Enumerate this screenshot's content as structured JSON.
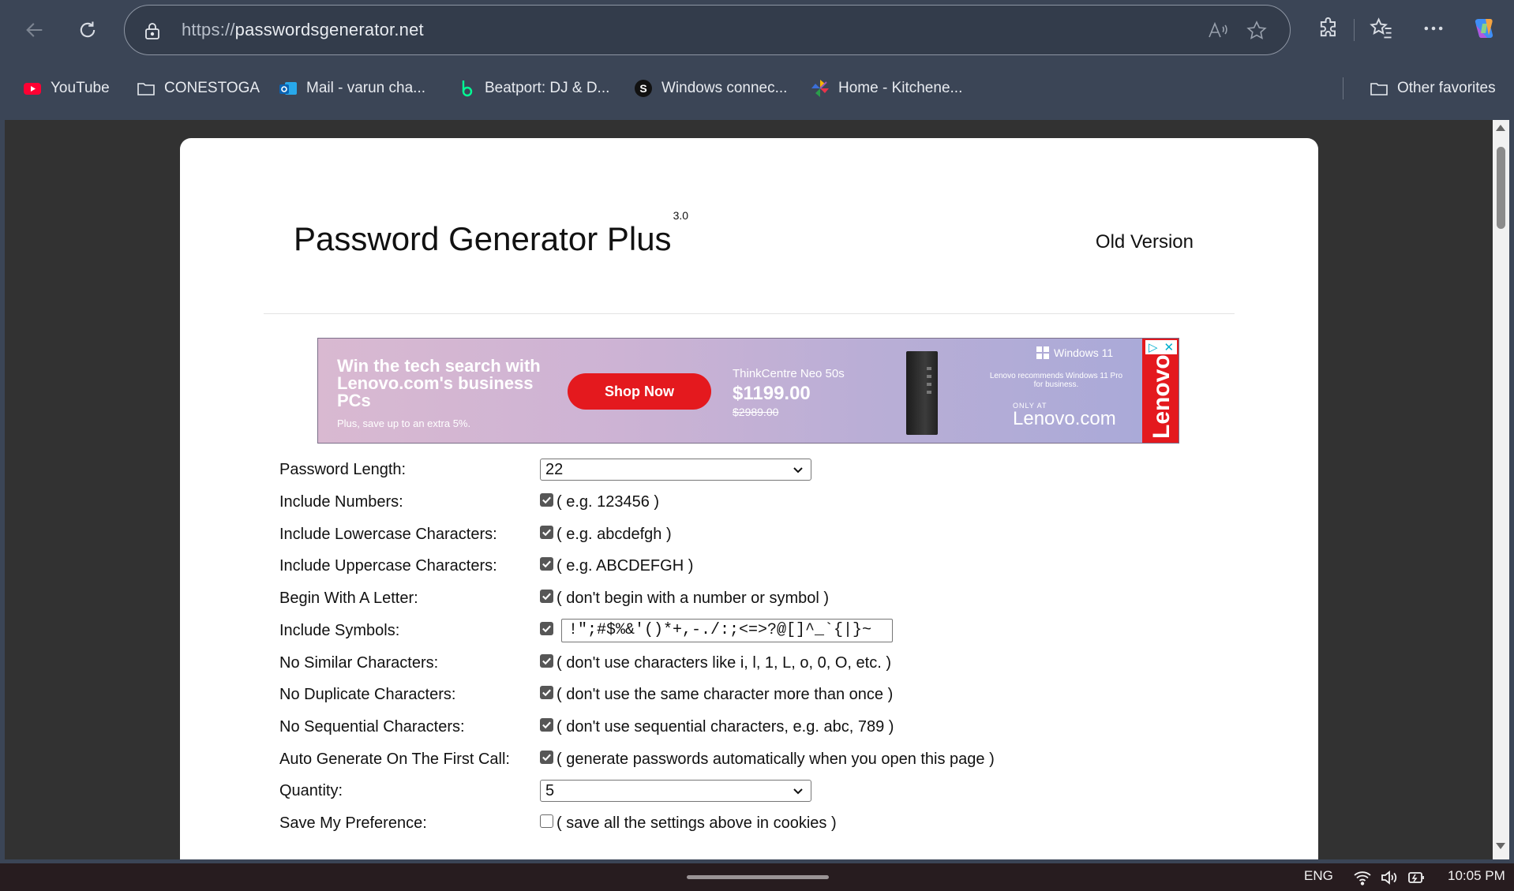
{
  "browser": {
    "url_scheme": "https://",
    "url_host": "passwordsgenerator.net",
    "icons": [
      "back-icon",
      "refresh-icon",
      "lock-icon",
      "read-aloud-icon",
      "favorite-star-icon",
      "extensions-icon",
      "favorites-icon",
      "more-icon",
      "copilot-icon"
    ]
  },
  "favorites": [
    {
      "label": "YouTube",
      "icon": "youtube-icon"
    },
    {
      "label": "CONESTOGA",
      "icon": "folder-icon"
    },
    {
      "label": "Mail - varun cha...",
      "icon": "outlook-icon"
    },
    {
      "label": "Beatport: DJ & D...",
      "icon": "beatport-icon"
    },
    {
      "label": "Windows connec...",
      "icon": "s-logo-icon"
    },
    {
      "label": "Home - Kitchene...",
      "icon": "pinwheel-icon"
    },
    {
      "label": "Other favorites",
      "icon": "folder-icon"
    }
  ],
  "page": {
    "title": "Password Generator Plus",
    "version": "3.0",
    "old_version_link": "Old Version"
  },
  "ad": {
    "headline": "Win the tech search with Lenovo.com's business PCs",
    "subline": "Plus, save up to an extra 5%.",
    "cta": "Shop Now",
    "model": "ThinkCentre Neo 50s",
    "price": "$1199.00",
    "old_price": "$2989.00",
    "windows_badge": "Windows 11",
    "recommend": "Lenovo recommends Windows 11 Pro for business.",
    "only_at": "ONLY AT",
    "site": "Lenovo.com",
    "brand": "Lenovo",
    "brand_color": "#e4191e"
  },
  "form": {
    "password_length": {
      "label": "Password Length:",
      "value": "22"
    },
    "include_numbers": {
      "label": "Include Numbers:",
      "hint": "( e.g. 123456 )",
      "checked": true
    },
    "include_lowercase": {
      "label": "Include Lowercase Characters:",
      "hint": "( e.g. abcdefgh )",
      "checked": true
    },
    "include_uppercase": {
      "label": "Include Uppercase Characters:",
      "hint": "( e.g. ABCDEFGH )",
      "checked": true
    },
    "begin_with_letter": {
      "label": "Begin With A Letter:",
      "hint": "( don't begin with a number or symbol )",
      "checked": true
    },
    "include_symbols": {
      "label": "Include Symbols:",
      "value": "!\";#$%&'()*+,-./:;<=>?@[]^_`{|}~",
      "checked": true
    },
    "no_similar": {
      "label": "No Similar Characters:",
      "hint": "( don't use characters like i, l, 1, L, o, 0, O, etc. )",
      "checked": true
    },
    "no_duplicate": {
      "label": "No Duplicate Characters:",
      "hint": "( don't use the same character more than once )",
      "checked": true
    },
    "no_sequential": {
      "label": "No Sequential Characters:",
      "hint": "( don't use sequential characters, e.g. abc, 789 )",
      "checked": true
    },
    "auto_generate": {
      "label": "Auto Generate On The First Call:",
      "hint": "( generate passwords automatically when you open this page )",
      "checked": true
    },
    "quantity": {
      "label": "Quantity:",
      "value": "5"
    },
    "save_preference": {
      "label": "Save My Preference:",
      "hint": "( save all the settings above in cookies )",
      "checked": false
    }
  },
  "taskbar": {
    "language": "ENG",
    "time": "10:05 PM",
    "icons": [
      "wifi-icon",
      "volume-icon",
      "battery-icon"
    ]
  }
}
